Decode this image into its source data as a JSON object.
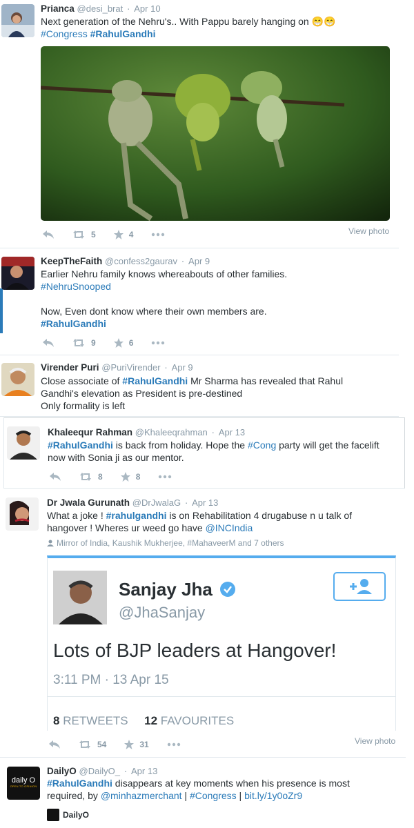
{
  "tweets": [
    {
      "name": "Prianca",
      "handle": "@desi_brat",
      "date": "Apr 10",
      "line1": "Next generation of the Nehru's.. With Pappu barely hanging on 😁😁",
      "tags": [
        "#Congress",
        "#RahulGandhi"
      ],
      "retweets": "5",
      "favorites": "4",
      "view_photo": "View photo"
    },
    {
      "name": "KeepTheFaith",
      "handle": "@confess2gaurav",
      "date": "Apr 9",
      "line1": "Earlier Nehru family knows whereabouts of other families.",
      "tag1": "#NehruSnooped",
      "line2": "Now, Even dont know where their own members are.",
      "tag2": "#RahulGandhi",
      "retweets": "9",
      "favorites": "6"
    },
    {
      "name": "Virender Puri",
      "handle": "@PuriVirender",
      "date": "Apr 9",
      "pre": "Close associate of ",
      "tag": "#RahulGandhi",
      "post": " Mr Sharma has revealed that Rahul",
      "line2": "Gandhi's elevation as President is pre-destined",
      "line3": "Only formality is left"
    },
    {
      "name": "Khaleequr Rahman",
      "handle": "@Khaleeqrahman",
      "date": "Apr 13",
      "tag": "#RahulGandhi",
      "mid": " is back from holiday. Hope the ",
      "tag2": "#Cong",
      "post": " party will get the facelift",
      "line2": "now with Sonia ji as our mentor.",
      "retweets": "8",
      "favorites": "8"
    },
    {
      "name": "Dr Jwala Gurunath",
      "handle": "@DrJwalaG",
      "date": "Apr 13",
      "pre": "What a joke ! ",
      "tag": "#rahulgandhi",
      "post": " is on Rehabilitation 4 drugabuse n u talk of",
      "line2pre": "hangover ! Wheres ur weed go have ",
      "mention": "@INCIndia",
      "tagged": "Mirror of India, Kaushik Mukherjee, #MahaveerM and 7 others",
      "card": {
        "name": "Sanjay Jha",
        "handle": "@JhaSanjay",
        "text": "Lots of BJP leaders at Hangover!",
        "time": "3:11 PM · 13 Apr 15",
        "rt_count": "8",
        "rt_label": "RETWEETS",
        "fav_count": "12",
        "fav_label": "FAVOURITES"
      },
      "retweets": "54",
      "favorites": "31",
      "view_photo": "View photo"
    },
    {
      "name": "DailyO",
      "handle": "@DailyO_",
      "date": "Apr 13",
      "tag": "#RahulGandhi",
      "post": " disappears at key moments when his presence is most",
      "line2pre": "required, by ",
      "mention": "@minhazmerchant",
      "sep1": " | ",
      "tag2": "#Congress",
      "sep2": " | ",
      "link": "bit.ly/1y0oZr9",
      "card_name": "DailyO",
      "logo_text": "daily O",
      "logo_sub": "OPEN TO OPINION"
    }
  ]
}
